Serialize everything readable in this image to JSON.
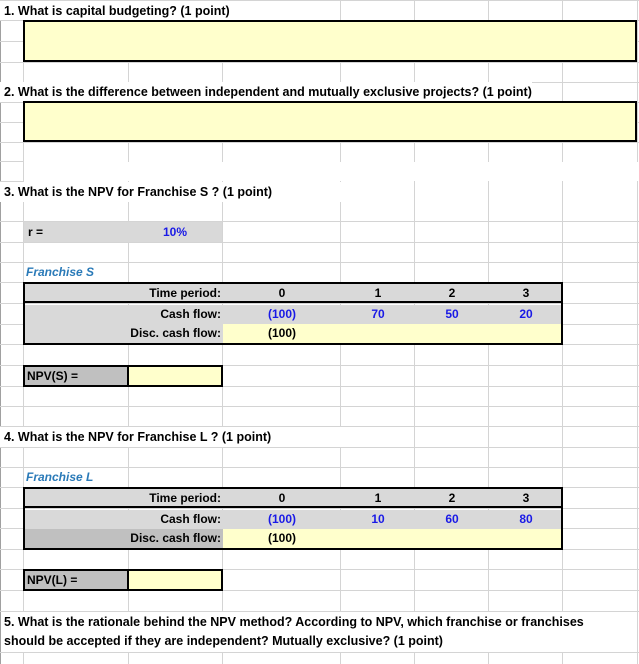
{
  "questions": {
    "q1": "1.  What is capital budgeting?  (1 point)",
    "q2": "2.  What is the difference between independent and mutually exclusive projects? (1 point)",
    "q3": "3.  What is the NPV for Franchise S ?  (1 point)",
    "q4": "4.  What is the NPV for Franchise L ?  (1 point)",
    "q5_line1": "5.  What is the rationale behind the NPV method?  According to NPV, which franchise or franchises",
    "q5_line2": "should be accepted if they are independent?  Mutually exclusive? (1 point)"
  },
  "answers": {
    "q1": "",
    "q2": "",
    "npv_s": "",
    "npv_l": ""
  },
  "rate": {
    "label": "r   =",
    "value": "10%"
  },
  "franchise_s": {
    "title": "Franchise S",
    "time_label": "Time period:",
    "cash_label": "Cash flow:",
    "disc_label": "Disc. cash flow:",
    "periods": [
      "0",
      "1",
      "2",
      "3"
    ],
    "cash_flows": [
      "(100)",
      "70",
      "50",
      "20"
    ],
    "disc_cash_flows": [
      "(100)",
      "",
      "",
      ""
    ],
    "npv_label": "NPV(S)   ="
  },
  "franchise_l": {
    "title": "Franchise L",
    "time_label": "Time period:",
    "cash_label": "Cash flow:",
    "disc_label": "Disc. cash flow:",
    "periods": [
      "0",
      "1",
      "2",
      "3"
    ],
    "cash_flows": [
      "(100)",
      "10",
      "60",
      "80"
    ],
    "disc_cash_flows": [
      "(100)",
      "",
      "",
      ""
    ],
    "npv_label": "NPV(L)   ="
  },
  "colors": {
    "input_yellow": "#ffffcc",
    "header_gray": "#d9d9d9",
    "label_dark_gray": "#c0c0c0",
    "input_blue": "#1a1ae6",
    "title_blue": "#2a7ab8"
  }
}
